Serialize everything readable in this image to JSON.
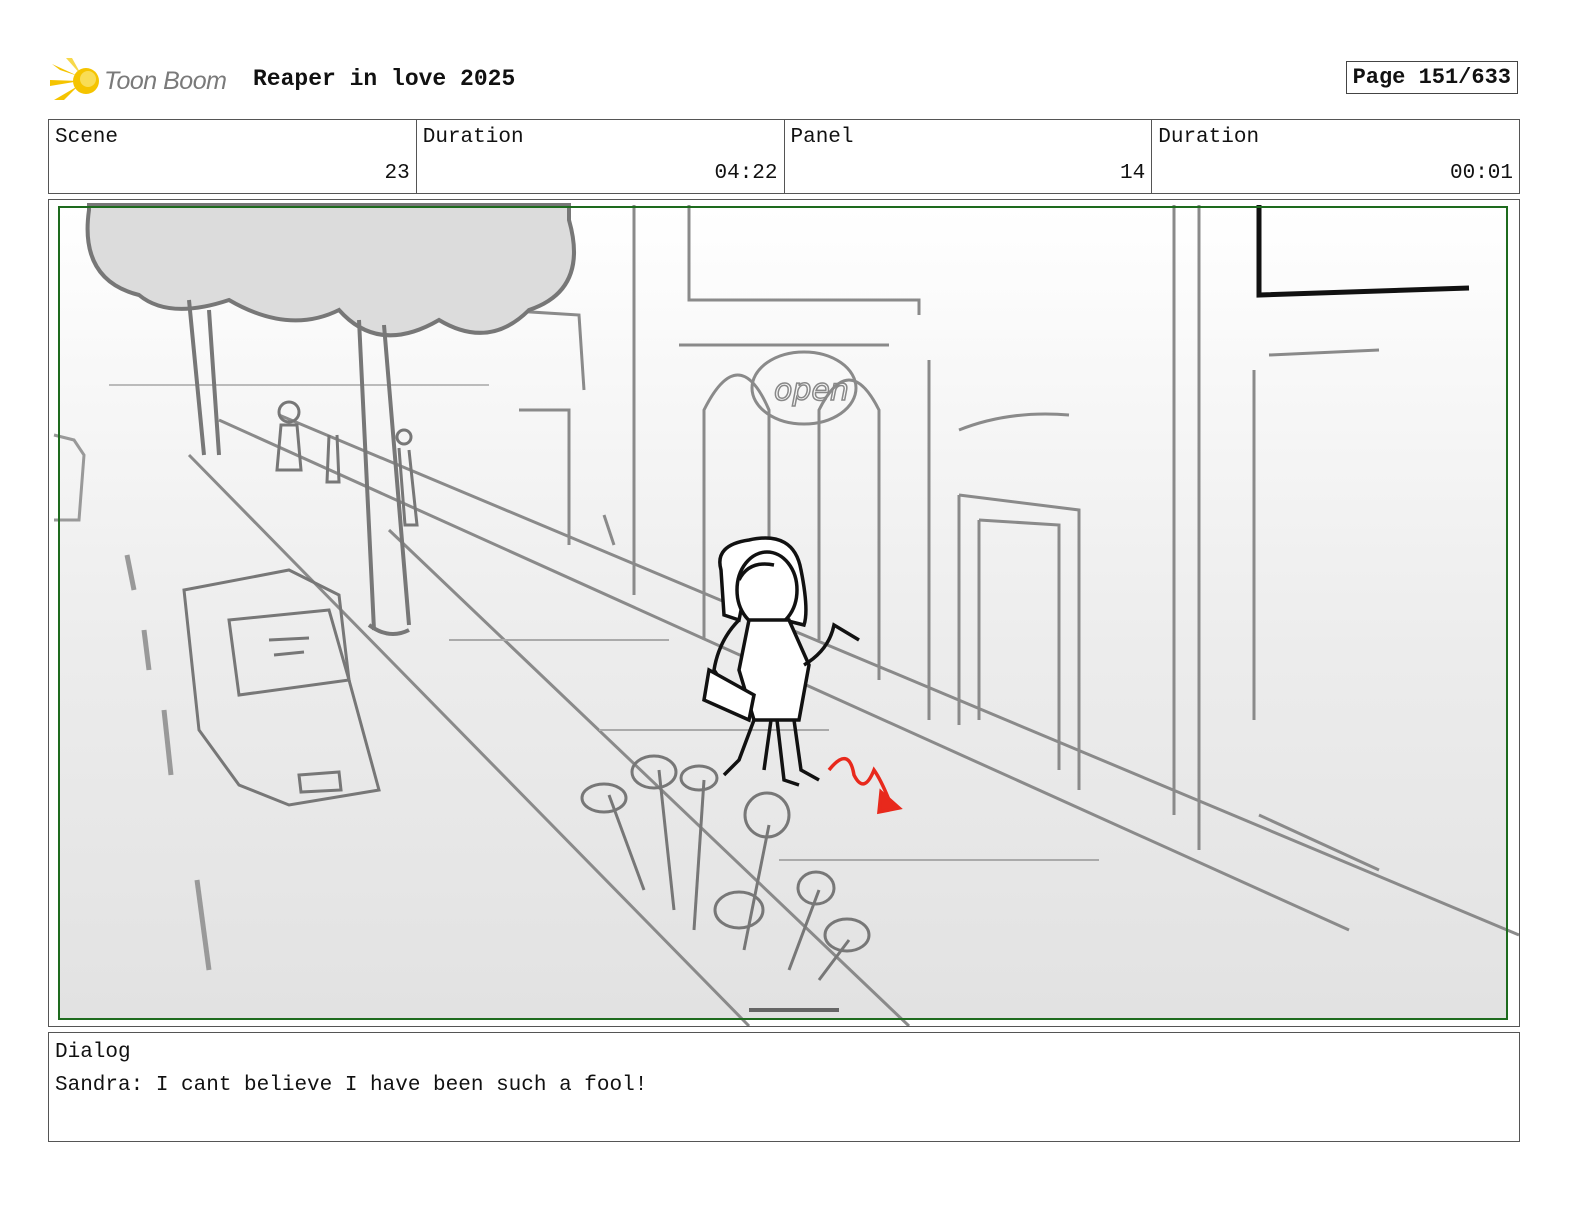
{
  "header": {
    "logo_text": "Toon Boom",
    "project_title": "Reaper in love 2025",
    "page_label": "Page 151/633"
  },
  "info": {
    "scene_label": "Scene",
    "scene_value": "23",
    "scene_duration_label": "Duration",
    "scene_duration_value": "04:22",
    "panel_label": "Panel",
    "panel_value": "14",
    "panel_duration_label": "Duration",
    "panel_duration_value": "00:01"
  },
  "panel_image": {
    "sign_text": "open",
    "frame_color": "#1e6b1e",
    "arrow_color": "#e8291c"
  },
  "dialog": {
    "label": "Dialog",
    "text": "Sandra: I cant believe I have been such a fool!"
  }
}
